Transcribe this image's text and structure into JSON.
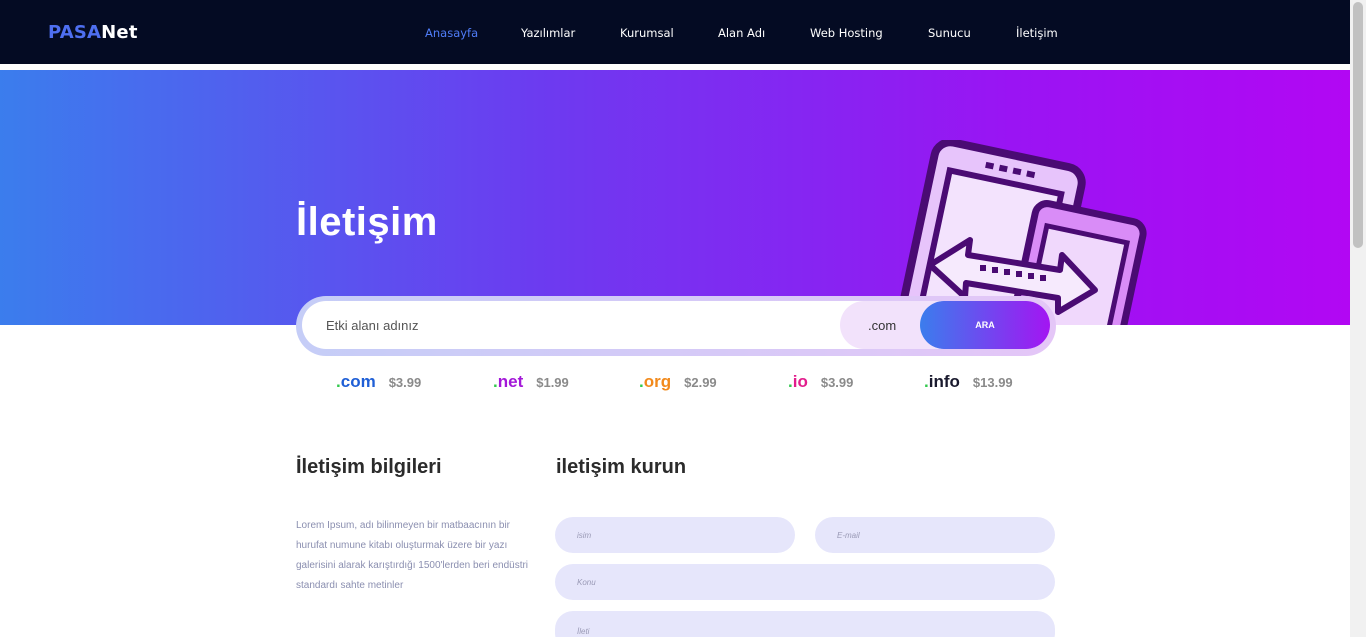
{
  "brand": {
    "part1": "PASA",
    "part2": "Net"
  },
  "nav": [
    {
      "label": "Anasayfa",
      "active": true
    },
    {
      "label": "Yazılımlar"
    },
    {
      "label": "Kurumsal"
    },
    {
      "label": "Alan Adı"
    },
    {
      "label": "Web Hosting"
    },
    {
      "label": "Sunucu"
    },
    {
      "label": "İletişim"
    }
  ],
  "hero": {
    "title": "İletişim"
  },
  "search": {
    "placeholder": "Etki alanı adınız",
    "tld": ".com",
    "button": "ARA"
  },
  "tlds": [
    {
      "dot": ".",
      "ext": "com",
      "price": "$3.99",
      "color": "#1f5fd6"
    },
    {
      "dot": ".",
      "ext": "net",
      "price": "$1.99",
      "color": "#a318d8"
    },
    {
      "dot": ".",
      "ext": "org",
      "price": "$2.99",
      "color": "#f28a1c"
    },
    {
      "dot": ".",
      "ext": "io",
      "price": "$3.99",
      "color": "#e21d8c"
    },
    {
      "dot": ".",
      "ext": "info",
      "price": "$13.99",
      "color": "#1a1a2e"
    }
  ],
  "contact_info": {
    "title": "İletişim bilgileri",
    "text": "Lorem Ipsum, adı bilinmeyen bir matbaacının bir hurufat numune kitabı oluşturmak üzere bir yazı galerisini alarak karıştırdığı 1500'lerden beri endüstri standardı sahte metinler"
  },
  "contact_form": {
    "title": "iletişim kurun",
    "name_placeholder": "isim",
    "email_placeholder": "E-mail",
    "subject_placeholder": "Konu",
    "message_placeholder": "İleti"
  },
  "colors": {
    "nav_bg": "#040b23",
    "accent": "#4f7cf6",
    "hero_start": "#3b7ded",
    "hero_end": "#b207f3",
    "field_bg": "#e6e6fb"
  }
}
